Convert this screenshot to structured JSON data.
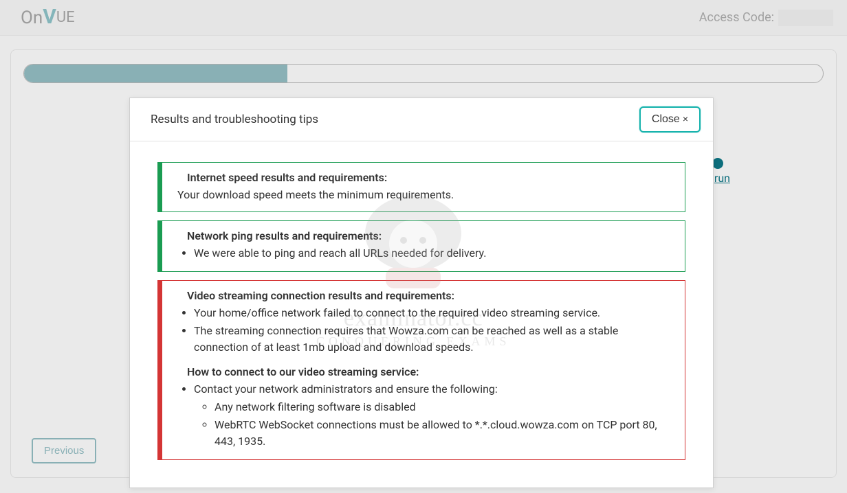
{
  "header": {
    "logo_on": "On",
    "logo_v": "V",
    "logo_ue": "UE",
    "access_label": "Access Code:"
  },
  "progress_pct": 33,
  "prev_label": "Previous",
  "background_link": "run",
  "modal": {
    "title": "Results and troubleshooting tips",
    "close": "Close",
    "tips": [
      {
        "status": "ok",
        "title": "Internet speed results and requirements:",
        "body_plain": "Your download speed meets the minimum requirements."
      },
      {
        "status": "ok",
        "title": "Network ping results and requirements:",
        "items": [
          "We were able to ping and reach all URLs needed for delivery."
        ]
      },
      {
        "status": "fail",
        "title": "Video streaming connection results and requirements:",
        "items": [
          "Your home/office network failed to connect to the required video streaming service.",
          "The streaming connection requires that Wowza.com can be reached as well as a stable connection of at least 1mb upload and download speeds."
        ],
        "second_title": "How to connect to our video streaming service:",
        "second_items": [
          {
            "text": "Contact your network administrators and ensure the following:",
            "sub": [
              "Any network filtering software is disabled",
              "WebRTC WebSocket connections must be allowed to *.*.cloud.wowza.com on TCP port 80, 443, 1935."
            ]
          }
        ]
      }
    ]
  },
  "watermark": {
    "line1": "examinator.cc",
    "line2": "Conquering Exams"
  }
}
